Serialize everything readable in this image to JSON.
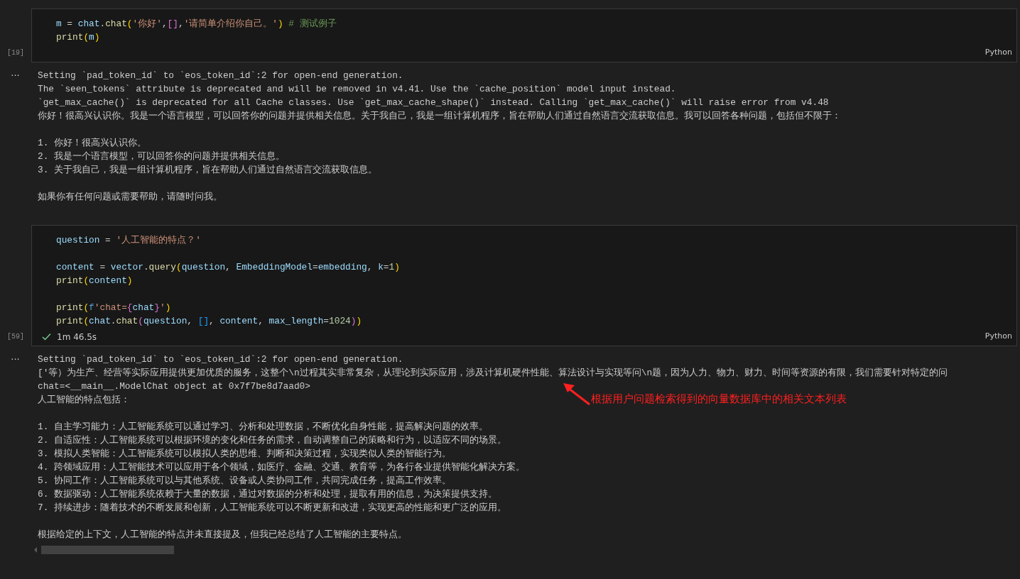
{
  "cells": [
    {
      "execution_count": "[19]",
      "language": "Python",
      "output_menu": "···",
      "code_blocks": [
        [
          [
            {
              "t": "m",
              "kind": "var"
            },
            {
              "t": " = ",
              "kind": "op"
            },
            {
              "t": "chat",
              "kind": "var"
            },
            {
              "t": ".",
              "kind": "op"
            },
            {
              "t": "chat",
              "kind": "fn"
            },
            {
              "t": "(",
              "kind": "b1"
            },
            {
              "t": "'你好'",
              "kind": "str"
            },
            {
              "t": ",",
              "kind": "op"
            },
            {
              "t": "[]",
              "kind": "b2"
            },
            {
              "t": ",",
              "kind": "op"
            },
            {
              "t": "'请简单介绍你自己。'",
              "kind": "str"
            },
            {
              "t": ")",
              "kind": "b1"
            },
            {
              "t": " # 测试例子",
              "kind": "comment"
            }
          ],
          [
            {
              "t": "print",
              "kind": "fn"
            },
            {
              "t": "(",
              "kind": "b1"
            },
            {
              "t": "m",
              "kind": "var"
            },
            {
              "t": ")",
              "kind": "b1"
            }
          ]
        ]
      ],
      "output_blocks": [
        [
          "Setting `pad_token_id` to `eos_token_id`:2 for open-end generation.",
          "The `seen_tokens` attribute is deprecated and will be removed in v4.41. Use the `cache_position` model input instead.",
          "`get_max_cache()` is deprecated for all Cache classes. Use `get_max_cache_shape()` instead. Calling `get_max_cache()` will raise error from v4.48",
          "你好！很高兴认识你。我是一个语言模型，可以回答你的问题并提供相关信息。关于我自己，我是一组计算机程序，旨在帮助人们通过自然语言交流获取信息。我可以回答各种问题，包括但不限于："
        ],
        [
          "1. 你好！很高兴认识你。",
          "2. 我是一个语言模型，可以回答你的问题并提供相关信息。",
          "3. 关于我自己，我是一组计算机程序，旨在帮助人们通过自然语言交流获取信息。"
        ],
        [
          "如果你有任何问题或需要帮助，请随时问我。"
        ]
      ]
    },
    {
      "execution_count": "[59]",
      "language": "Python",
      "output_menu": "···",
      "status": {
        "success": true,
        "duration": "1m 46.5s"
      },
      "code_blocks": [
        [
          [
            {
              "t": "question",
              "kind": "var"
            },
            {
              "t": " = ",
              "kind": "op"
            },
            {
              "t": "'人工智能的特点？'",
              "kind": "str"
            }
          ]
        ],
        [
          [
            {
              "t": "content",
              "kind": "var"
            },
            {
              "t": " = ",
              "kind": "op"
            },
            {
              "t": "vector",
              "kind": "var"
            },
            {
              "t": ".",
              "kind": "op"
            },
            {
              "t": "query",
              "kind": "fn"
            },
            {
              "t": "(",
              "kind": "b1"
            },
            {
              "t": "question",
              "kind": "var"
            },
            {
              "t": ", ",
              "kind": "op"
            },
            {
              "t": "EmbeddingModel",
              "kind": "var"
            },
            {
              "t": "=",
              "kind": "op"
            },
            {
              "t": "embedding",
              "kind": "var"
            },
            {
              "t": ", ",
              "kind": "op"
            },
            {
              "t": "k",
              "kind": "var"
            },
            {
              "t": "=",
              "kind": "op"
            },
            {
              "t": "1",
              "kind": "num"
            },
            {
              "t": ")",
              "kind": "b1"
            }
          ],
          [
            {
              "t": "print",
              "kind": "fn"
            },
            {
              "t": "(",
              "kind": "b1"
            },
            {
              "t": "content",
              "kind": "var"
            },
            {
              "t": ")",
              "kind": "b1"
            }
          ]
        ],
        [
          [
            {
              "t": "print",
              "kind": "fn"
            },
            {
              "t": "(",
              "kind": "b1"
            },
            {
              "t": "f",
              "kind": "kw"
            },
            {
              "t": "'chat=",
              "kind": "str"
            },
            {
              "t": "{",
              "kind": "b2"
            },
            {
              "t": "chat",
              "kind": "var"
            },
            {
              "t": "}",
              "kind": "b2"
            },
            {
              "t": "'",
              "kind": "str"
            },
            {
              "t": ")",
              "kind": "b1"
            }
          ],
          [
            {
              "t": "print",
              "kind": "fn"
            },
            {
              "t": "(",
              "kind": "b1"
            },
            {
              "t": "chat",
              "kind": "var"
            },
            {
              "t": ".",
              "kind": "op"
            },
            {
              "t": "chat",
              "kind": "fn"
            },
            {
              "t": "(",
              "kind": "b2"
            },
            {
              "t": "question",
              "kind": "var"
            },
            {
              "t": ", ",
              "kind": "op"
            },
            {
              "t": "[]",
              "kind": "b3"
            },
            {
              "t": ", ",
              "kind": "op"
            },
            {
              "t": "content",
              "kind": "var"
            },
            {
              "t": ", ",
              "kind": "op"
            },
            {
              "t": "max_length",
              "kind": "var"
            },
            {
              "t": "=",
              "kind": "op"
            },
            {
              "t": "1024",
              "kind": "num"
            },
            {
              "t": ")",
              "kind": "b2"
            },
            {
              "t": ")",
              "kind": "b1"
            }
          ]
        ]
      ],
      "output_blocks": [
        [
          "Setting `pad_token_id` to `eos_token_id`:2 for open-end generation.",
          "['等）为生产、经营等实际应用提供更加优质的服务，这整个\\n过程其实非常复杂，从理论到实际应用，涉及计算机硬件性能、算法设计与实现等问\\n题，因为人力、物力、财力、时间等资源的有限，我们需要针对特定的问",
          "chat=<__main__.ModelChat object at 0x7f7be8d7aad0>",
          "人工智能的特点包括："
        ],
        [
          "1. 自主学习能力：人工智能系统可以通过学习、分析和处理数据，不断优化自身性能，提高解决问题的效率。",
          "2. 自适应性：人工智能系统可以根据环境的变化和任务的需求，自动调整自己的策略和行为，以适应不同的场景。",
          "3. 模拟人类智能：人工智能系统可以模拟人类的思维、判断和决策过程，实现类似人类的智能行为。",
          "4. 跨领域应用：人工智能技术可以应用于各个领域，如医疗、金融、交通、教育等，为各行各业提供智能化解决方案。",
          "5. 协同工作：人工智能系统可以与其他系统、设备或人类协同工作，共同完成任务，提高工作效率。",
          "6. 数据驱动：人工智能系统依赖于大量的数据，通过对数据的分析和处理，提取有用的信息，为决策提供支持。",
          "7. 持续进步：随着技术的不断发展和创新，人工智能系统可以不断更新和改进，实现更高的性能和更广泛的应用。"
        ],
        [
          "根据给定的上下文，人工智能的特点并未直接提及，但我已经总结了人工智能的主要特点。"
        ]
      ],
      "annotation": {
        "text": "根据用户问题检索得到的向量数据库中的相关文本列表"
      }
    }
  ]
}
